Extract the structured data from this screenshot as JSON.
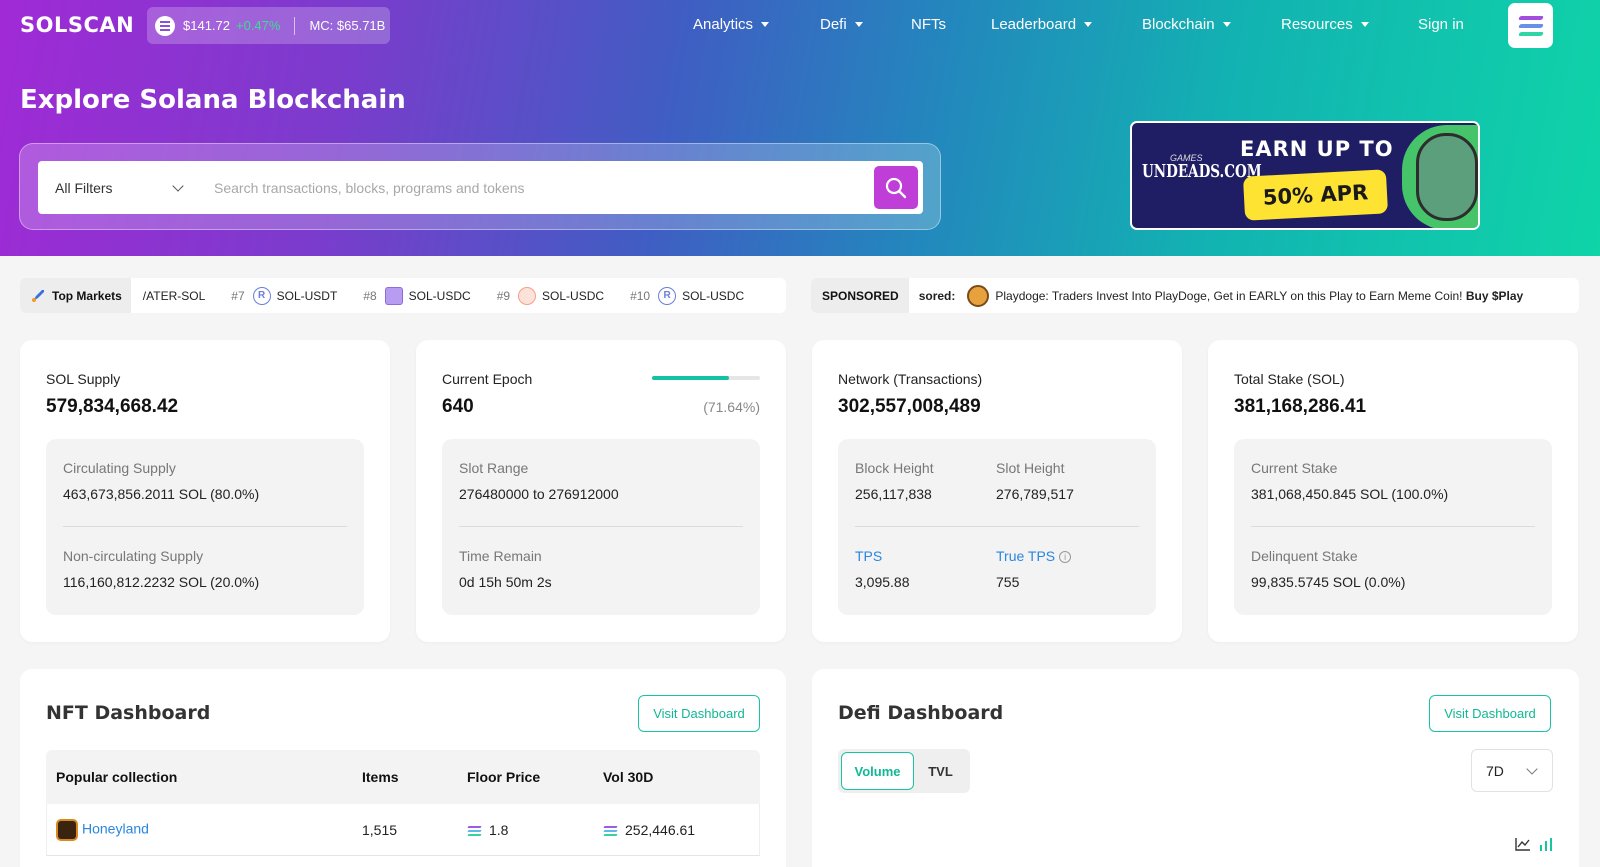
{
  "header": {
    "logo": "SOLSCAN",
    "price": "$141.72",
    "price_change": "+0.47%",
    "market_cap": "MC: $65.71B",
    "nav": [
      {
        "label": "Analytics",
        "dropdown": true
      },
      {
        "label": "Defi",
        "dropdown": true
      },
      {
        "label": "NFTs",
        "dropdown": false
      },
      {
        "label": "Leaderboard",
        "dropdown": true
      },
      {
        "label": "Blockchain",
        "dropdown": true
      },
      {
        "label": "Resources",
        "dropdown": true
      },
      {
        "label": "Sign in",
        "dropdown": false
      }
    ]
  },
  "hero": {
    "title": "Explore Solana Blockchain",
    "filter_label": "All Filters",
    "search_placeholder": "Search transactions, blocks, programs and tokens"
  },
  "ad": {
    "brand_small": "GAMES",
    "brand": "UNDEADS.COM",
    "headline": "EARN UP TO",
    "offer": "50% APR"
  },
  "markets": {
    "label": "Top Markets",
    "items": [
      {
        "rank": "",
        "pair": "/ATER-SOL"
      },
      {
        "rank": "#7",
        "pair": "SOL-USDT"
      },
      {
        "rank": "#8",
        "pair": "SOL-USDC"
      },
      {
        "rank": "#9",
        "pair": "SOL-USDC"
      },
      {
        "rank": "#10",
        "pair": "SOL-USDC"
      }
    ]
  },
  "sponsored": {
    "label": "SPONSORED",
    "prefix": "sored:",
    "text": "Playdoge: Traders Invest Into PlayDoge, Get in EARLY on this Play to Earn Meme Coin!",
    "cta": "Buy $Play"
  },
  "stats": {
    "supply": {
      "title": "SOL Supply",
      "value": "579,834,668.42",
      "circ_label": "Circulating Supply",
      "circ_value": "463,673,856.2011 SOL (80.0%)",
      "noncirc_label": "Non-circulating Supply",
      "noncirc_value": "116,160,812.2232 SOL (20.0%)"
    },
    "epoch": {
      "title": "Current Epoch",
      "value": "640",
      "progress": 0.7164,
      "progress_label": "(71.64%)",
      "slot_label": "Slot Range",
      "slot_value": "276480000 to 276912000",
      "time_label": "Time Remain",
      "time_value": "0d 15h 50m 2s"
    },
    "network": {
      "title": "Network (Transactions)",
      "value": "302,557,008,489",
      "block_label": "Block Height",
      "block_value": "256,117,838",
      "slot_label": "Slot Height",
      "slot_value": "276,789,517",
      "tps_label": "TPS",
      "tps_value": "3,095.88",
      "true_tps_label": "True TPS",
      "true_tps_value": "755"
    },
    "stake": {
      "title": "Total Stake (SOL)",
      "value": "381,168,286.41",
      "current_label": "Current Stake",
      "current_value": "381,068,450.845 SOL (100.0%)",
      "delinquent_label": "Delinquent Stake",
      "delinquent_value": "99,835.5745 SOL (0.0%)"
    }
  },
  "nft_dashboard": {
    "title": "NFT Dashboard",
    "visit_label": "Visit Dashboard",
    "columns": [
      "Popular collection",
      "Items",
      "Floor Price",
      "Vol 30D"
    ],
    "rows": [
      {
        "name": "Honeyland",
        "items": "1,515",
        "floor": "1.8",
        "vol": "252,446.61"
      }
    ]
  },
  "defi_dashboard": {
    "title": "Defi Dashboard",
    "visit_label": "Visit Dashboard",
    "tab_active": "Volume",
    "tab_other": "TVL",
    "range": "7D"
  },
  "colors": {
    "accent": "#19c4a3",
    "link": "#2a86e0",
    "search_button": "#c03ed8"
  }
}
